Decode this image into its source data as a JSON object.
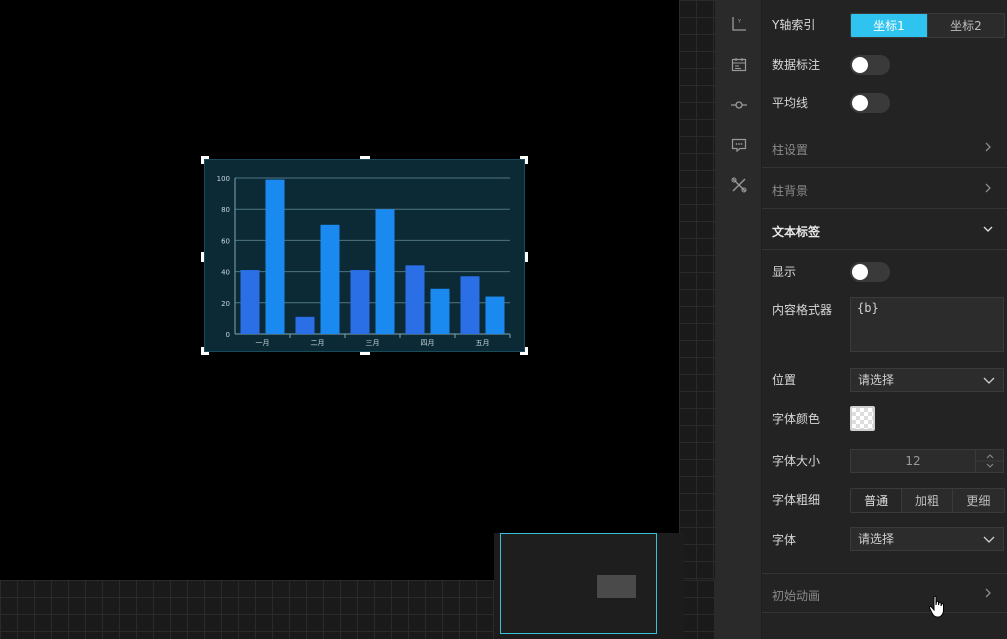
{
  "chart_data": {
    "type": "bar",
    "categories": [
      "一月",
      "二月",
      "三月",
      "四月",
      "五月"
    ],
    "series": [
      {
        "values": [
          41,
          11,
          41,
          44,
          37
        ]
      },
      {
        "values": [
          99,
          70,
          80,
          29,
          24
        ]
      }
    ],
    "y_ticks": [
      "0",
      "20",
      "40",
      "60",
      "80",
      "100"
    ],
    "ylim": [
      0,
      100
    ],
    "grid": true,
    "colors": [
      "#2b6fe6",
      "#1a8af0"
    ]
  },
  "icons": [
    "axis-icon",
    "calendar-icon",
    "commit-icon",
    "comment-icon",
    "tools-icon"
  ],
  "panel": {
    "y_axis_index": {
      "label": "Y轴索引",
      "options": [
        "坐标1",
        "坐标2"
      ],
      "selected": 0
    },
    "data_mark": {
      "label": "数据标注",
      "on": false
    },
    "avg_line": {
      "label": "平均线",
      "on": false
    },
    "sections": {
      "bar_settings": "柱设置",
      "bar_background": "柱背景",
      "text_label": "文本标签",
      "initial_animation": "初始动画"
    },
    "text_label": {
      "show": {
        "label": "显示",
        "on": false
      },
      "formatter": {
        "label": "内容格式器",
        "value": "{b}"
      },
      "position": {
        "label": "位置",
        "placeholder": "请选择"
      },
      "font_color": {
        "label": "字体颜色"
      },
      "font_size": {
        "label": "字体大小",
        "value": "12"
      },
      "font_weight": {
        "label": "字体粗细",
        "options": [
          "普通",
          "加粗",
          "更细"
        ],
        "selected": 0
      },
      "font": {
        "label": "字体",
        "placeholder": "请选择"
      }
    }
  }
}
